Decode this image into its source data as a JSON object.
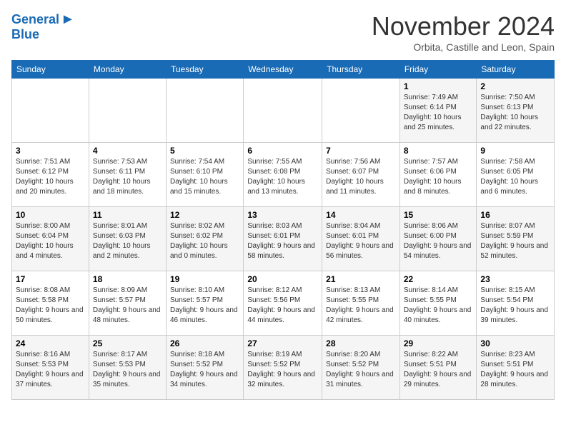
{
  "header": {
    "logo_line1": "General",
    "logo_line2": "Blue",
    "month": "November 2024",
    "location": "Orbita, Castille and Leon, Spain"
  },
  "days_of_week": [
    "Sunday",
    "Monday",
    "Tuesday",
    "Wednesday",
    "Thursday",
    "Friday",
    "Saturday"
  ],
  "weeks": [
    [
      {
        "day": "",
        "info": ""
      },
      {
        "day": "",
        "info": ""
      },
      {
        "day": "",
        "info": ""
      },
      {
        "day": "",
        "info": ""
      },
      {
        "day": "",
        "info": ""
      },
      {
        "day": "1",
        "info": "Sunrise: 7:49 AM\nSunset: 6:14 PM\nDaylight: 10 hours and 25 minutes."
      },
      {
        "day": "2",
        "info": "Sunrise: 7:50 AM\nSunset: 6:13 PM\nDaylight: 10 hours and 22 minutes."
      }
    ],
    [
      {
        "day": "3",
        "info": "Sunrise: 7:51 AM\nSunset: 6:12 PM\nDaylight: 10 hours and 20 minutes."
      },
      {
        "day": "4",
        "info": "Sunrise: 7:53 AM\nSunset: 6:11 PM\nDaylight: 10 hours and 18 minutes."
      },
      {
        "day": "5",
        "info": "Sunrise: 7:54 AM\nSunset: 6:10 PM\nDaylight: 10 hours and 15 minutes."
      },
      {
        "day": "6",
        "info": "Sunrise: 7:55 AM\nSunset: 6:08 PM\nDaylight: 10 hours and 13 minutes."
      },
      {
        "day": "7",
        "info": "Sunrise: 7:56 AM\nSunset: 6:07 PM\nDaylight: 10 hours and 11 minutes."
      },
      {
        "day": "8",
        "info": "Sunrise: 7:57 AM\nSunset: 6:06 PM\nDaylight: 10 hours and 8 minutes."
      },
      {
        "day": "9",
        "info": "Sunrise: 7:58 AM\nSunset: 6:05 PM\nDaylight: 10 hours and 6 minutes."
      }
    ],
    [
      {
        "day": "10",
        "info": "Sunrise: 8:00 AM\nSunset: 6:04 PM\nDaylight: 10 hours and 4 minutes."
      },
      {
        "day": "11",
        "info": "Sunrise: 8:01 AM\nSunset: 6:03 PM\nDaylight: 10 hours and 2 minutes."
      },
      {
        "day": "12",
        "info": "Sunrise: 8:02 AM\nSunset: 6:02 PM\nDaylight: 10 hours and 0 minutes."
      },
      {
        "day": "13",
        "info": "Sunrise: 8:03 AM\nSunset: 6:01 PM\nDaylight: 9 hours and 58 minutes."
      },
      {
        "day": "14",
        "info": "Sunrise: 8:04 AM\nSunset: 6:01 PM\nDaylight: 9 hours and 56 minutes."
      },
      {
        "day": "15",
        "info": "Sunrise: 8:06 AM\nSunset: 6:00 PM\nDaylight: 9 hours and 54 minutes."
      },
      {
        "day": "16",
        "info": "Sunrise: 8:07 AM\nSunset: 5:59 PM\nDaylight: 9 hours and 52 minutes."
      }
    ],
    [
      {
        "day": "17",
        "info": "Sunrise: 8:08 AM\nSunset: 5:58 PM\nDaylight: 9 hours and 50 minutes."
      },
      {
        "day": "18",
        "info": "Sunrise: 8:09 AM\nSunset: 5:57 PM\nDaylight: 9 hours and 48 minutes."
      },
      {
        "day": "19",
        "info": "Sunrise: 8:10 AM\nSunset: 5:57 PM\nDaylight: 9 hours and 46 minutes."
      },
      {
        "day": "20",
        "info": "Sunrise: 8:12 AM\nSunset: 5:56 PM\nDaylight: 9 hours and 44 minutes."
      },
      {
        "day": "21",
        "info": "Sunrise: 8:13 AM\nSunset: 5:55 PM\nDaylight: 9 hours and 42 minutes."
      },
      {
        "day": "22",
        "info": "Sunrise: 8:14 AM\nSunset: 5:55 PM\nDaylight: 9 hours and 40 minutes."
      },
      {
        "day": "23",
        "info": "Sunrise: 8:15 AM\nSunset: 5:54 PM\nDaylight: 9 hours and 39 minutes."
      }
    ],
    [
      {
        "day": "24",
        "info": "Sunrise: 8:16 AM\nSunset: 5:53 PM\nDaylight: 9 hours and 37 minutes."
      },
      {
        "day": "25",
        "info": "Sunrise: 8:17 AM\nSunset: 5:53 PM\nDaylight: 9 hours and 35 minutes."
      },
      {
        "day": "26",
        "info": "Sunrise: 8:18 AM\nSunset: 5:52 PM\nDaylight: 9 hours and 34 minutes."
      },
      {
        "day": "27",
        "info": "Sunrise: 8:19 AM\nSunset: 5:52 PM\nDaylight: 9 hours and 32 minutes."
      },
      {
        "day": "28",
        "info": "Sunrise: 8:20 AM\nSunset: 5:52 PM\nDaylight: 9 hours and 31 minutes."
      },
      {
        "day": "29",
        "info": "Sunrise: 8:22 AM\nSunset: 5:51 PM\nDaylight: 9 hours and 29 minutes."
      },
      {
        "day": "30",
        "info": "Sunrise: 8:23 AM\nSunset: 5:51 PM\nDaylight: 9 hours and 28 minutes."
      }
    ]
  ]
}
